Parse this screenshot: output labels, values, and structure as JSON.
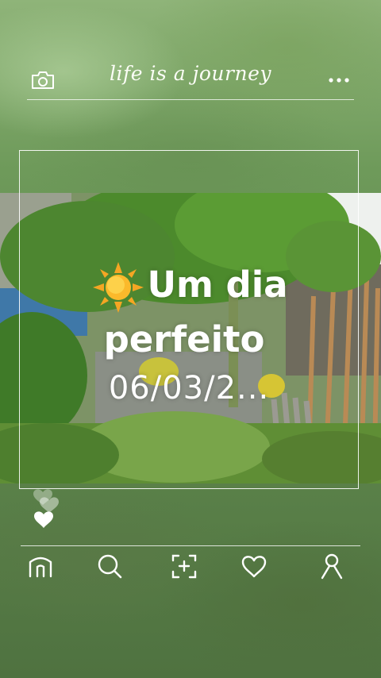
{
  "header": {
    "brand_title": "life is a journey",
    "left_icon": "camera-icon",
    "right_icon": "more-dots-icon"
  },
  "post": {
    "image": "papaya tree in a garden with wooden fence",
    "caption_line1": "Um dia",
    "caption_line2": "perfeito",
    "caption_line3": "06/03/2..."
  },
  "reactions": {
    "icon": "heart-icon"
  },
  "bottom_nav": {
    "items": [
      {
        "name": "home-icon"
      },
      {
        "name": "search-icon"
      },
      {
        "name": "add-photo-icon"
      },
      {
        "name": "favorites-heart-icon"
      },
      {
        "name": "profile-icon"
      }
    ]
  },
  "colors": {
    "text": "#ffffff",
    "lines": "#ffffff",
    "background": "#5f8750"
  }
}
